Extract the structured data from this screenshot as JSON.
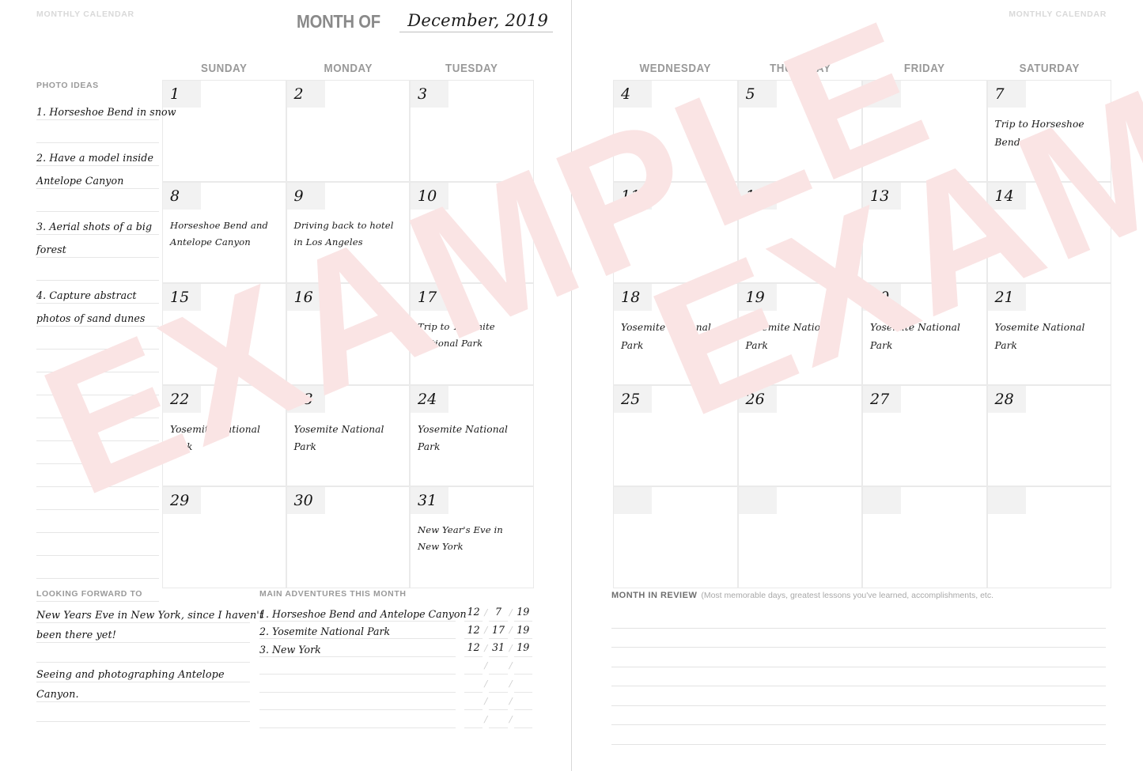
{
  "corner_labels": {
    "left": "MONTHLY CALENDAR",
    "right": "MONTHLY CALENDAR"
  },
  "header": {
    "month_of_label": "MONTH OF",
    "month_value": "December, 2019"
  },
  "days_left": [
    "SUNDAY",
    "MONDAY",
    "TUESDAY"
  ],
  "days_right": [
    "WEDNESDAY",
    "THURSDAY",
    "FRIDAY",
    "SATURDAY"
  ],
  "photo_ideas": {
    "title": "PHOTO IDEAS",
    "lines": [
      "1. Horseshoe Bend in snow",
      "",
      "2. Have a model  inside",
      "Antelope Canyon",
      "",
      "3. Aerial shots of a big",
      "forest",
      "",
      "4. Capture abstract",
      "photos of sand dunes",
      "",
      "",
      "",
      "",
      "",
      "",
      "",
      "",
      "",
      "",
      "",
      ""
    ]
  },
  "calendar_left": [
    [
      {
        "day": "1",
        "entry": ""
      },
      {
        "day": "2",
        "entry": ""
      },
      {
        "day": "3",
        "entry": ""
      }
    ],
    [
      {
        "day": "8",
        "entry": "Horseshoe Bend and Antelope Canyon"
      },
      {
        "day": "9",
        "entry": "Driving back to hotel in Los Angeles"
      },
      {
        "day": "10",
        "entry": ""
      }
    ],
    [
      {
        "day": "15",
        "entry": ""
      },
      {
        "day": "16",
        "entry": ""
      },
      {
        "day": "17",
        "entry": "Trip to Yosemite National Park"
      }
    ],
    [
      {
        "day": "22",
        "entry": "Yosemite National Park"
      },
      {
        "day": "23",
        "entry": "Yosemite National Park"
      },
      {
        "day": "24",
        "entry": "Yosemite National Park"
      }
    ],
    [
      {
        "day": "29",
        "entry": ""
      },
      {
        "day": "30",
        "entry": ""
      },
      {
        "day": "31",
        "entry": "New Year's Eve in New York"
      }
    ]
  ],
  "calendar_right": [
    [
      {
        "day": "4",
        "entry": ""
      },
      {
        "day": "5",
        "entry": ""
      },
      {
        "day": "6",
        "entry": ""
      },
      {
        "day": "7",
        "entry": "Trip to Horseshoe Bend"
      }
    ],
    [
      {
        "day": "11",
        "entry": ""
      },
      {
        "day": "12",
        "entry": ""
      },
      {
        "day": "13",
        "entry": ""
      },
      {
        "day": "14",
        "entry": ""
      }
    ],
    [
      {
        "day": "18",
        "entry": "Yosemite National Park"
      },
      {
        "day": "19",
        "entry": "Yosemite National Park"
      },
      {
        "day": "20",
        "entry": "Yosemite National Park"
      },
      {
        "day": "21",
        "entry": "Yosemite National Park"
      }
    ],
    [
      {
        "day": "25",
        "entry": ""
      },
      {
        "day": "26",
        "entry": ""
      },
      {
        "day": "27",
        "entry": ""
      },
      {
        "day": "28",
        "entry": ""
      }
    ],
    [
      {
        "day": "",
        "entry": ""
      },
      {
        "day": "",
        "entry": ""
      },
      {
        "day": "",
        "entry": ""
      },
      {
        "day": "",
        "entry": ""
      }
    ]
  ],
  "looking_forward": {
    "title": "LOOKING FORWARD TO",
    "lines": [
      "New Years Eve in New York, since I haven't",
      "been there yet!",
      "",
      "Seeing and photographing Antelope",
      "Canyon.",
      ""
    ]
  },
  "adventures": {
    "title": "MAIN ADVENTURES THIS MONTH",
    "rows": [
      {
        "name": "1. Horseshoe Bend and Antelope Canyon",
        "mm": "12",
        "dd": "7",
        "yy": "19"
      },
      {
        "name": "2. Yosemite National Park",
        "mm": "12",
        "dd": "17",
        "yy": "19"
      },
      {
        "name": "3. New York",
        "mm": "12",
        "dd": "31",
        "yy": "19"
      },
      {
        "name": "",
        "mm": "",
        "dd": "",
        "yy": ""
      },
      {
        "name": "",
        "mm": "",
        "dd": "",
        "yy": ""
      },
      {
        "name": "",
        "mm": "",
        "dd": "",
        "yy": ""
      },
      {
        "name": "",
        "mm": "",
        "dd": "",
        "yy": ""
      }
    ],
    "separator": "/"
  },
  "month_review": {
    "title": "MONTH IN REVIEW",
    "hint": "(Most memorable days, greatest lessons you've learned, accomplishments, etc.",
    "line_count": 7
  },
  "watermark": {
    "text": "EXAMPLE",
    "color": "#fae4e4"
  },
  "colors": {
    "daybox": "#f2f2f2",
    "cell_border": "#eaeaea",
    "rule": "#e6e6e6",
    "heading_gray": "#9a9a9a"
  }
}
